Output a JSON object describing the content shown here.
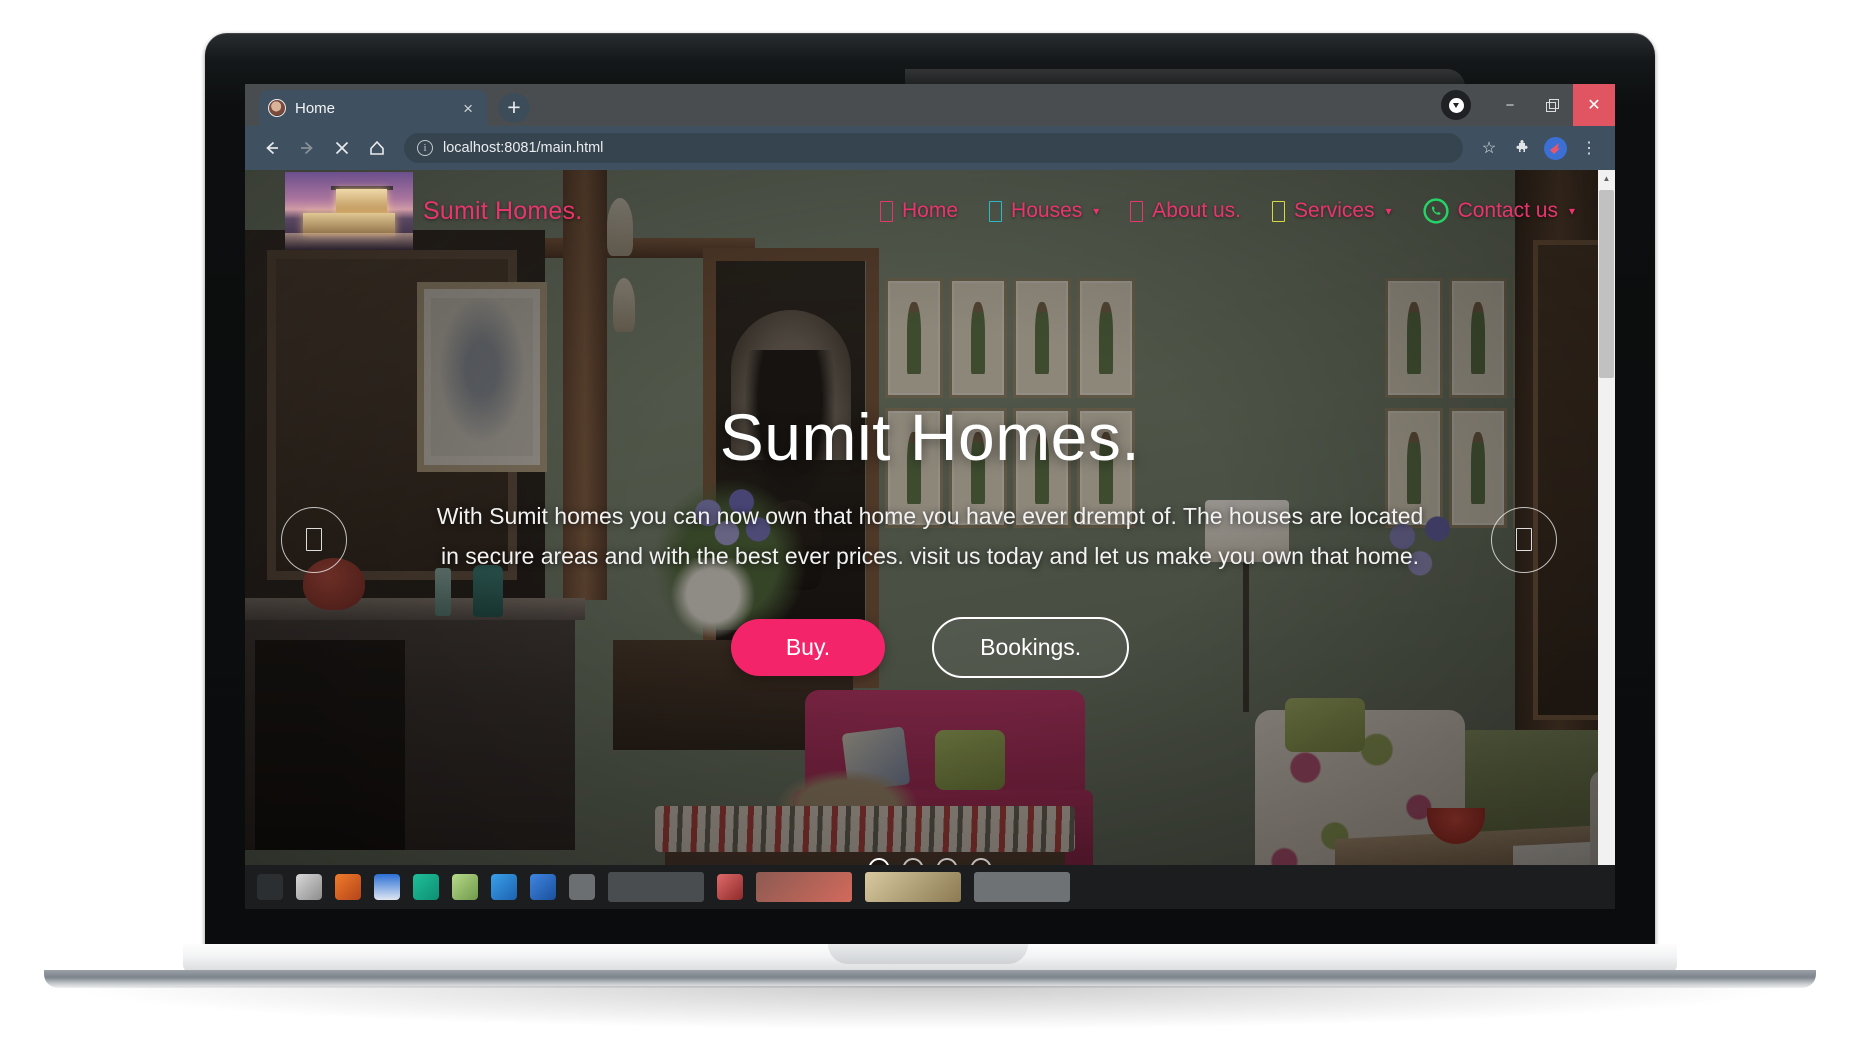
{
  "browser": {
    "tab": {
      "title": "Home",
      "favicon": "avatar-favicon",
      "close_label": "×"
    },
    "new_tab_label": "+",
    "window_controls": {
      "minimize": "−",
      "maximize": "❐",
      "close": "✕"
    },
    "toolbar": {
      "back": "←",
      "forward": "→",
      "stop": "✕",
      "home": "⌂",
      "url": "localhost:8081/main.html",
      "url_host": "localhost:8081",
      "url_path": "/main.html",
      "security_icon": "i",
      "bookmark_star": "☆",
      "extensions": "puzzle-piece-icon",
      "menu": "⋮"
    }
  },
  "site": {
    "brand": {
      "name": "Sumit Homes.",
      "logo_alt": "modern-house-photo",
      "color": "#e8356d"
    },
    "nav": [
      {
        "label": "Home",
        "icon": "tofu-box",
        "icon_color": "#e8356d",
        "has_dropdown": false,
        "caret": ""
      },
      {
        "label": "Houses",
        "icon": "tofu-box",
        "icon_color": "#2bb8c4",
        "has_dropdown": true,
        "caret": "▾"
      },
      {
        "label": "About us.",
        "icon": "tofu-box",
        "icon_color": "#e8356d",
        "has_dropdown": false,
        "caret": ""
      },
      {
        "label": "Services",
        "icon": "tofu-box",
        "icon_color": "#d8d83f",
        "has_dropdown": true,
        "caret": "▾"
      },
      {
        "label": "Contact us",
        "icon": "whatsapp-icon",
        "icon_color": "#25d366",
        "has_dropdown": true,
        "caret": "▾"
      }
    ],
    "hero": {
      "title": "Sumit Homes.",
      "description": "With Sumit homes you can now own that home you have ever drempt of. The houses are located in secure areas and with the best ever prices. visit us today and let us make you own that home.",
      "buttons": {
        "primary": "Buy.",
        "secondary": "Bookings."
      },
      "primary_color": "#f4246b",
      "background_alt": "victorian-living-room-photo"
    },
    "carousel": {
      "prev_label": "tofu-box",
      "next_label": "tofu-box",
      "slide_count": 4,
      "active_slide": 1
    }
  },
  "scrollbar": {
    "up": "▲",
    "down": "▼"
  },
  "taskbar": {
    "item_count": 14
  }
}
